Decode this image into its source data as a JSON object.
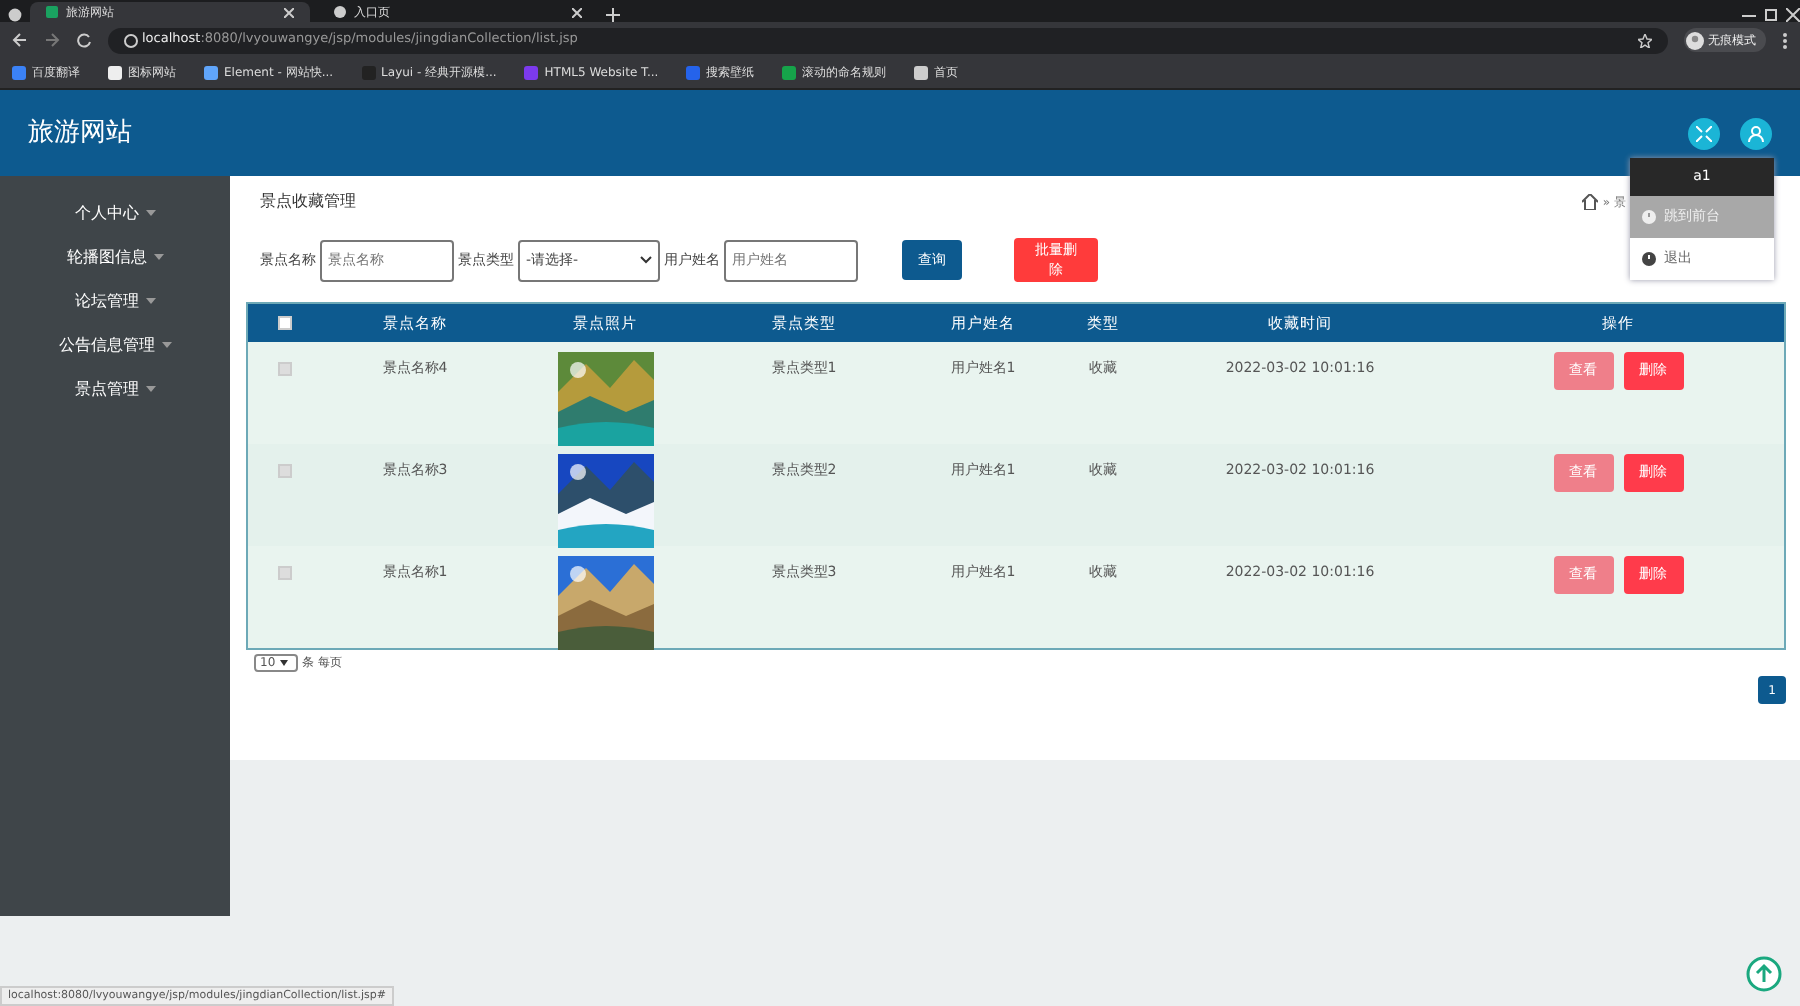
{
  "browser": {
    "tabs": [
      {
        "title": "旅游网站",
        "selected": true
      },
      {
        "title": "入口页",
        "selected": false
      }
    ],
    "address": {
      "host": "localhost",
      "path": ":8080/lvyouwangye/jsp/modules/jingdianCollection/list.jsp"
    },
    "profile": "无痕模式",
    "bookmarks": [
      "百度翻译",
      "图标网站",
      "Element - 网站快...",
      "Layui - 经典开源模...",
      "HTML5 Website T...",
      "搜索壁纸",
      "滚动的命名规则",
      "首页"
    ]
  },
  "app": {
    "title": "旅游网站",
    "sidebar": {
      "items": [
        "个人中心",
        "轮播图信息",
        "论坛管理",
        "公告信息管理",
        "景点管理"
      ]
    },
    "user_menu": {
      "username": "a1",
      "items": [
        {
          "label": "跳到前台",
          "selected": true
        },
        {
          "label": "退出",
          "selected": false
        }
      ]
    },
    "breadcrumb": "» 景",
    "page_title": "景点收藏管理",
    "filters": [
      {
        "label": "景点名称",
        "kind": "text",
        "placeholder": "景点名称"
      },
      {
        "label": "景点类型",
        "kind": "select",
        "value": "-请选择-"
      },
      {
        "label": "用户姓名",
        "kind": "text",
        "placeholder": "用户姓名"
      }
    ],
    "buttons": [
      "查询",
      "批量删除"
    ],
    "table": {
      "select_all": {
        "checked": false
      },
      "columns": [
        "景点名称",
        "景点照片",
        "景点类型",
        "用户姓名",
        "类型",
        "收藏时间",
        "操作"
      ],
      "rows": [
        {
          "checked": false,
          "name": "景点名称4",
          "photo": {
            "kind": "picture"
          },
          "type": "景点类型1",
          "user": "用户姓名1",
          "category": "收藏",
          "time": "2022-03-02 10:01:16",
          "actions": [
            "查看",
            "删除"
          ]
        },
        {
          "checked": false,
          "name": "景点名称3",
          "photo": {
            "kind": "picture"
          },
          "type": "景点类型2",
          "user": "用户姓名1",
          "category": "收藏",
          "time": "2022-03-02 10:01:16",
          "actions": [
            "查看",
            "删除"
          ]
        },
        {
          "checked": false,
          "name": "景点名称1",
          "photo": {
            "kind": "picture"
          },
          "type": "景点类型3",
          "user": "用户姓名1",
          "category": "收藏",
          "time": "2022-03-02 10:01:16",
          "actions": [
            "查看",
            "删除"
          ]
        }
      ]
    },
    "page_size": {
      "value": "10",
      "suffix": "条 每页"
    },
    "pages": [
      {
        "label": "1",
        "selected": true
      }
    ]
  },
  "status_bar": "localhost:8080/lvyouwangye/jsp/modules/jingdianCollection/list.jsp#"
}
